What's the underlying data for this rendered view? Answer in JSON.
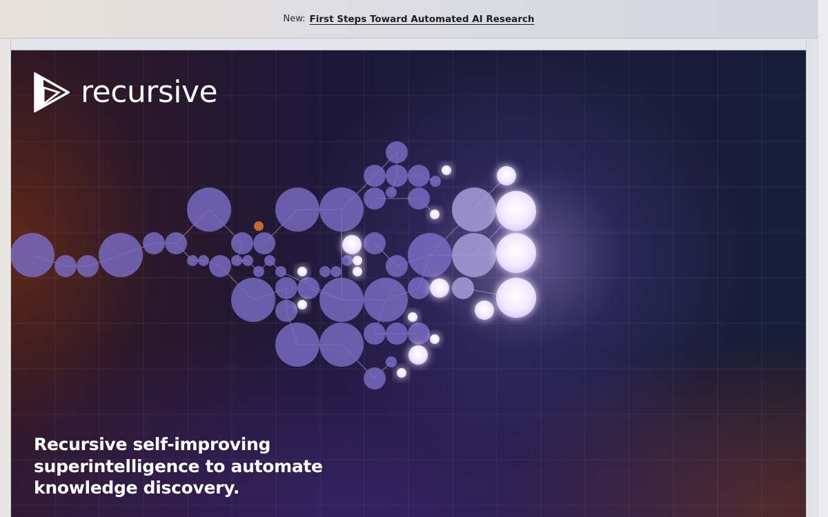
{
  "announcement": {
    "prefix": "New:",
    "link_text": "First Steps Toward Automated AI Research"
  },
  "brand": {
    "name": "recursive",
    "logo_icon": "play-triangle-logo-icon"
  },
  "hero": {
    "tagline_lines": [
      "Recursive self-improving",
      "superintelligence to automate",
      "knowledge discovery."
    ]
  },
  "colors": {
    "node_fill": "#7a6cc4",
    "node_bright": "#f4eeff",
    "accent_node": "#c8662e",
    "grid_line": "#ffffff"
  }
}
